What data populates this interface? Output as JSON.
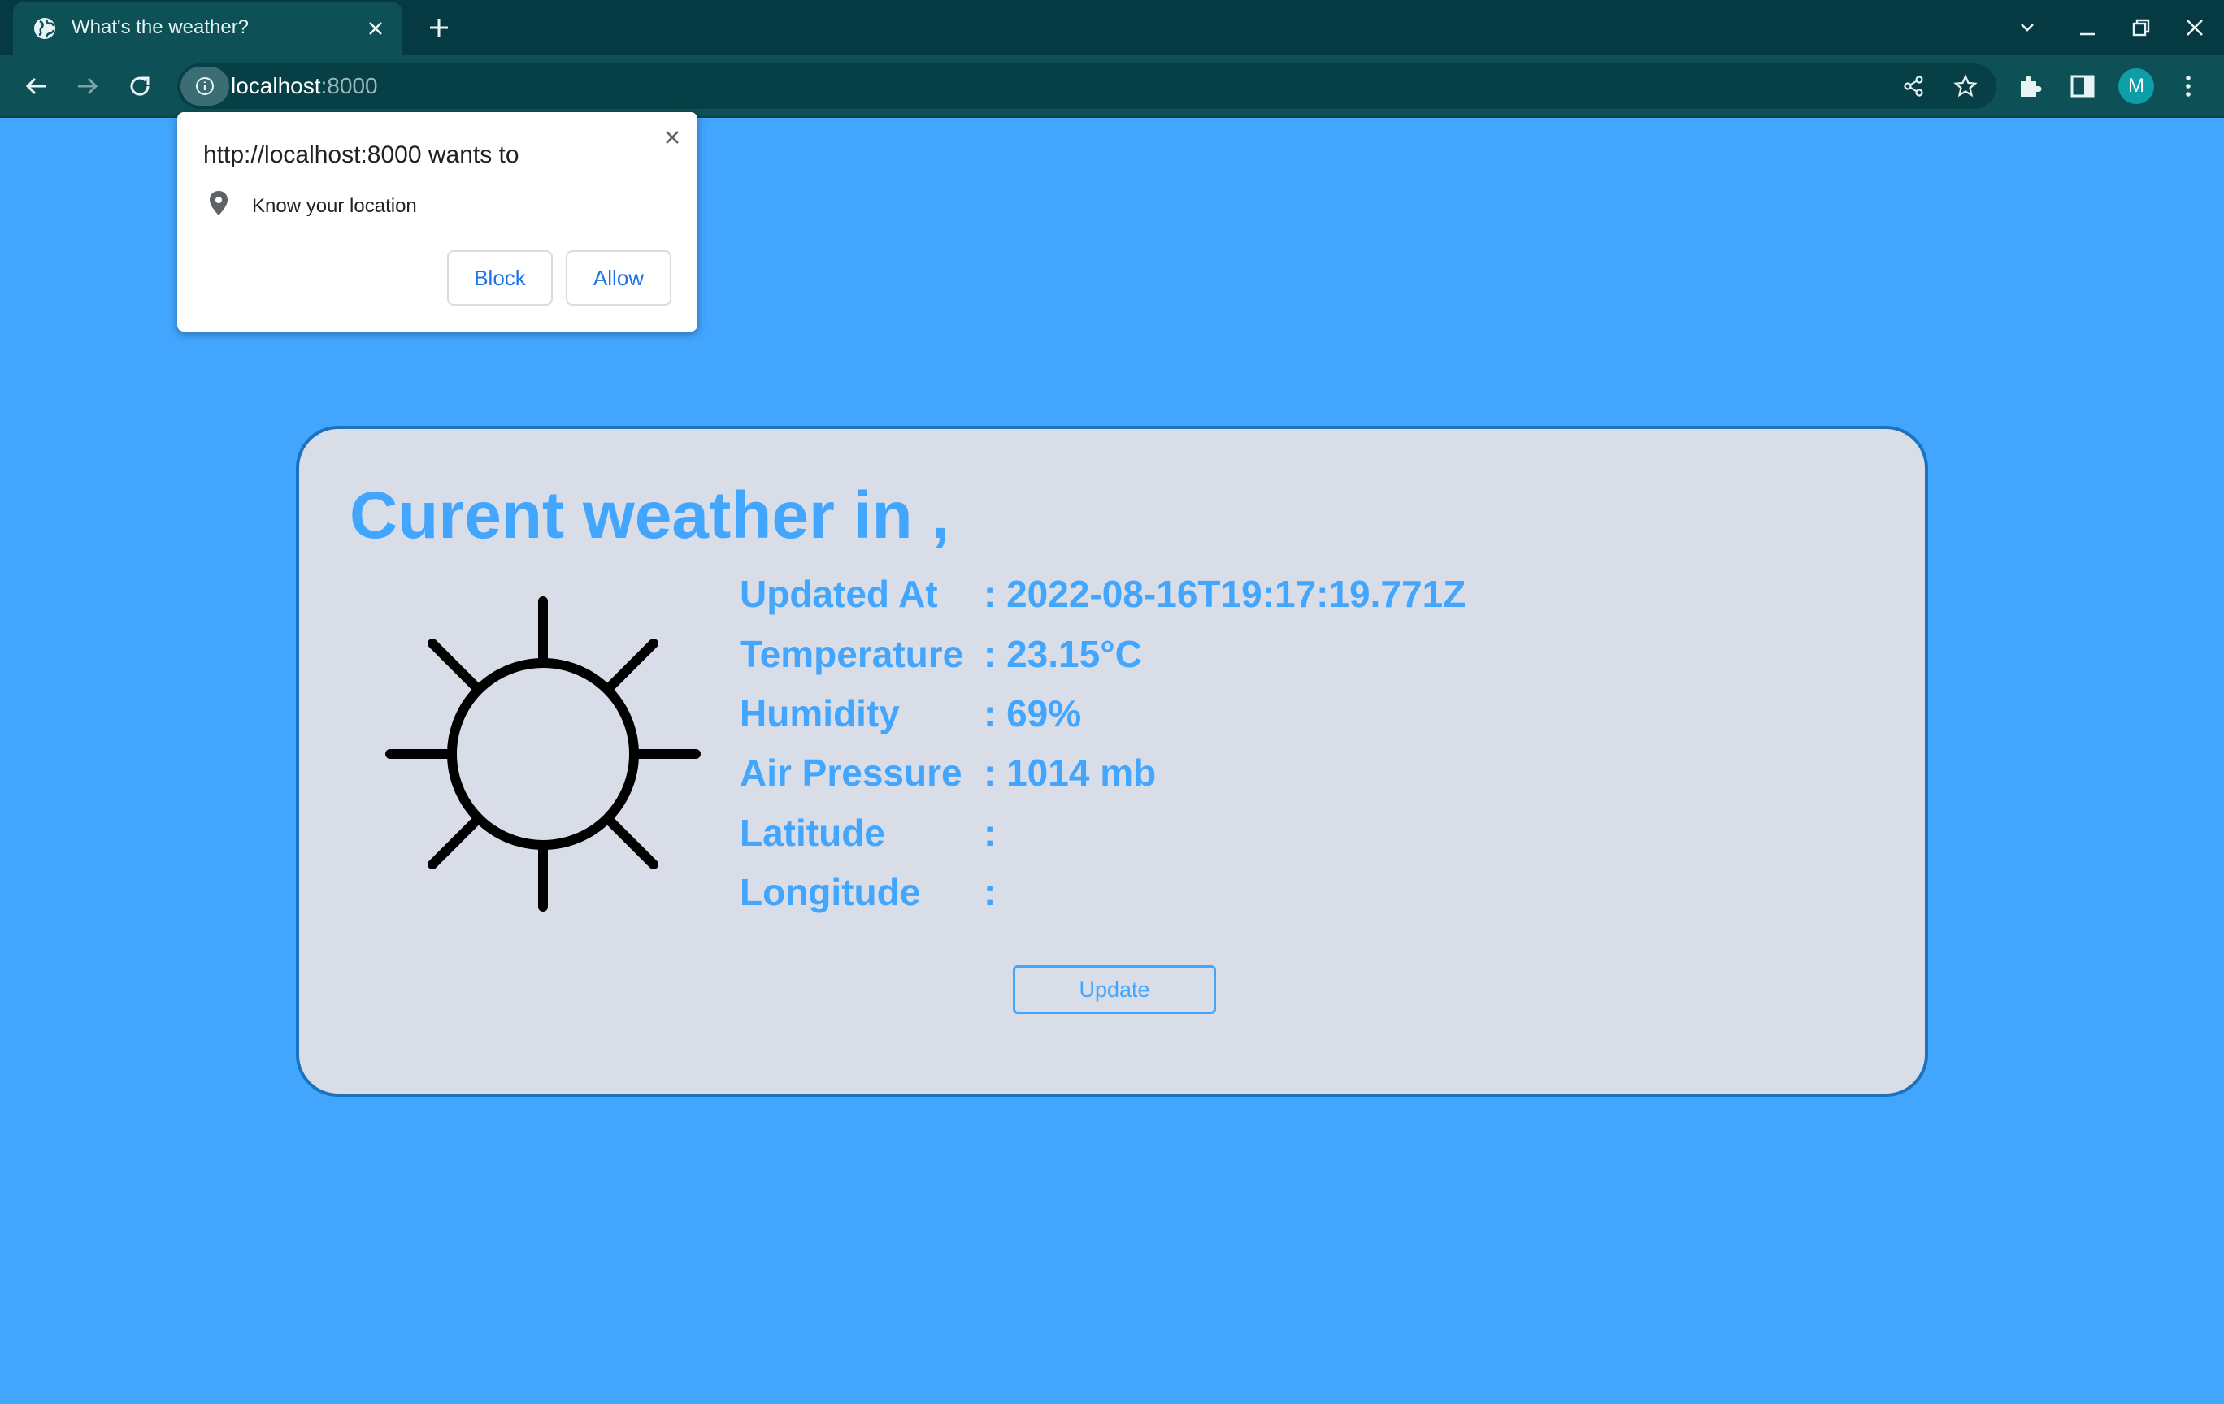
{
  "browser": {
    "tab_title": "What's the weather?",
    "url_host": "localhost",
    "url_port": ":8000",
    "profile_initial": "M"
  },
  "permission_prompt": {
    "title": "http://localhost:8000 wants to",
    "permission": "Know your location",
    "block_label": "Block",
    "allow_label": "Allow"
  },
  "weather": {
    "heading": "Curent weather in ,",
    "icon": "sun-icon",
    "rows": [
      {
        "label": "Updated At",
        "value": ": 2022-08-16T19:17:19.771Z"
      },
      {
        "label": "Temperature",
        "value": ": 23.15°C"
      },
      {
        "label": "Humidity",
        "value": ": 69%"
      },
      {
        "label": "Air Pressure",
        "value": ": 1014 mb"
      },
      {
        "label": "Latitude",
        "value": ":"
      },
      {
        "label": "Longitude",
        "value": ":"
      }
    ],
    "update_label": "Update"
  },
  "colors": {
    "page_background": "#42a5fe",
    "card_background": "#d9dde7",
    "card_border": "#1b72bd",
    "accent_text": "#42a5fe",
    "chrome_dark": "#063a43",
    "chrome_toolbar": "#0d5157",
    "link_blue": "#1a73e8"
  }
}
